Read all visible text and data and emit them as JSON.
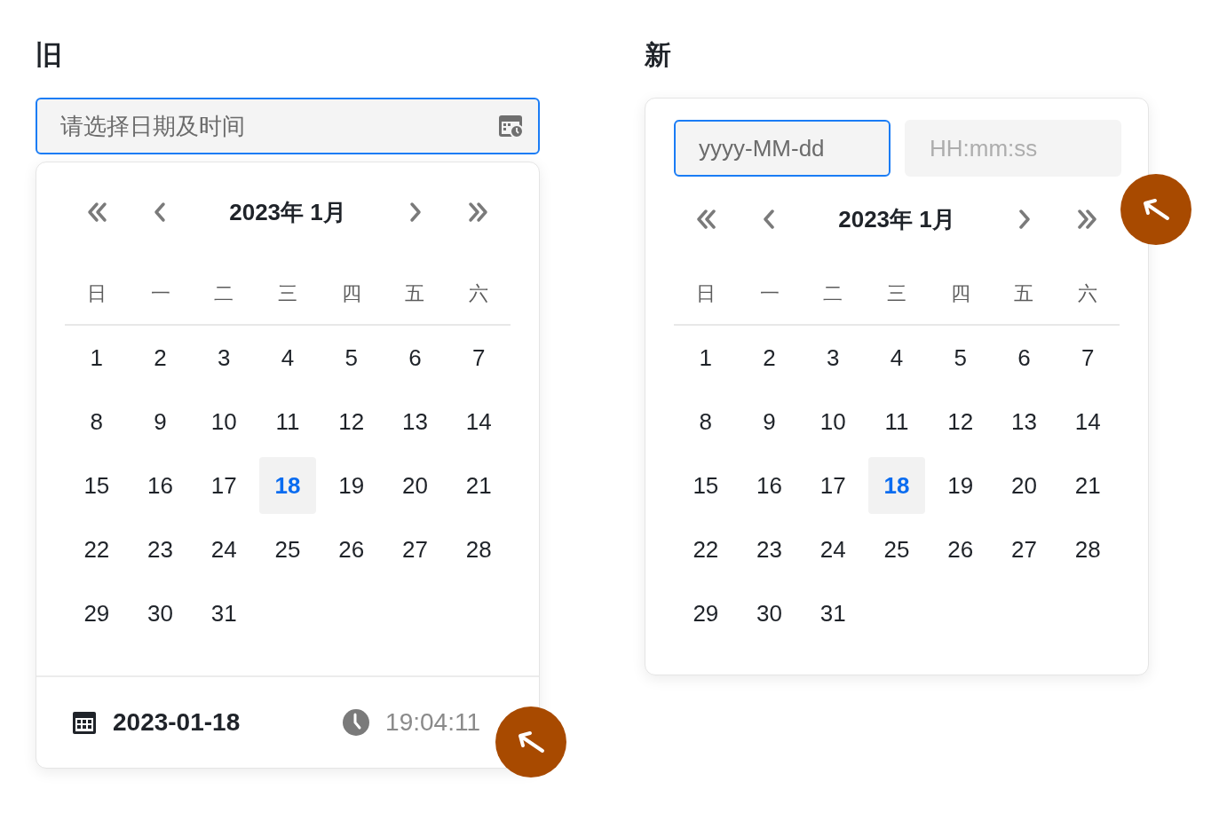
{
  "panels": [
    {
      "title": "旧",
      "kind": "single",
      "input": {
        "placeholder": "请选择日期及时间",
        "focused": true
      },
      "calendar": {
        "month_label": "2023年 1月",
        "weekdays": [
          "日",
          "一",
          "二",
          "三",
          "四",
          "五",
          "六"
        ],
        "days": [
          {
            "label": "1",
            "selected": false
          },
          {
            "label": "2",
            "selected": false
          },
          {
            "label": "3",
            "selected": false
          },
          {
            "label": "4",
            "selected": false
          },
          {
            "label": "5",
            "selected": false
          },
          {
            "label": "6",
            "selected": false
          },
          {
            "label": "7",
            "selected": false
          },
          {
            "label": "8",
            "selected": false
          },
          {
            "label": "9",
            "selected": false
          },
          {
            "label": "10",
            "selected": false
          },
          {
            "label": "11",
            "selected": false
          },
          {
            "label": "12",
            "selected": false
          },
          {
            "label": "13",
            "selected": false
          },
          {
            "label": "14",
            "selected": false
          },
          {
            "label": "15",
            "selected": false
          },
          {
            "label": "16",
            "selected": false
          },
          {
            "label": "17",
            "selected": false
          },
          {
            "label": "18",
            "selected": true
          },
          {
            "label": "19",
            "selected": false
          },
          {
            "label": "20",
            "selected": false
          },
          {
            "label": "21",
            "selected": false
          },
          {
            "label": "22",
            "selected": false
          },
          {
            "label": "23",
            "selected": false
          },
          {
            "label": "24",
            "selected": false
          },
          {
            "label": "25",
            "selected": false
          },
          {
            "label": "26",
            "selected": false
          },
          {
            "label": "27",
            "selected": false
          },
          {
            "label": "28",
            "selected": false
          },
          {
            "label": "29",
            "selected": false
          },
          {
            "label": "30",
            "selected": false
          },
          {
            "label": "31",
            "selected": false
          }
        ]
      },
      "footer": {
        "date": "2023-01-18",
        "time": "19:04:11"
      }
    },
    {
      "title": "新",
      "kind": "split",
      "date_input": {
        "placeholder": "yyyy-MM-dd",
        "focused": true
      },
      "time_input": {
        "placeholder": "HH:mm:ss",
        "focused": false
      },
      "calendar": {
        "month_label": "2023年 1月",
        "weekdays": [
          "日",
          "一",
          "二",
          "三",
          "四",
          "五",
          "六"
        ],
        "days": [
          {
            "label": "1",
            "selected": false
          },
          {
            "label": "2",
            "selected": false
          },
          {
            "label": "3",
            "selected": false
          },
          {
            "label": "4",
            "selected": false
          },
          {
            "label": "5",
            "selected": false
          },
          {
            "label": "6",
            "selected": false
          },
          {
            "label": "7",
            "selected": false
          },
          {
            "label": "8",
            "selected": false
          },
          {
            "label": "9",
            "selected": false
          },
          {
            "label": "10",
            "selected": false
          },
          {
            "label": "11",
            "selected": false
          },
          {
            "label": "12",
            "selected": false
          },
          {
            "label": "13",
            "selected": false
          },
          {
            "label": "14",
            "selected": false
          },
          {
            "label": "15",
            "selected": false
          },
          {
            "label": "16",
            "selected": false
          },
          {
            "label": "17",
            "selected": false
          },
          {
            "label": "18",
            "selected": true
          },
          {
            "label": "19",
            "selected": false
          },
          {
            "label": "20",
            "selected": false
          },
          {
            "label": "21",
            "selected": false
          },
          {
            "label": "22",
            "selected": false
          },
          {
            "label": "23",
            "selected": false
          },
          {
            "label": "24",
            "selected": false
          },
          {
            "label": "25",
            "selected": false
          },
          {
            "label": "26",
            "selected": false
          },
          {
            "label": "27",
            "selected": false
          },
          {
            "label": "28",
            "selected": false
          },
          {
            "label": "29",
            "selected": false
          },
          {
            "label": "30",
            "selected": false
          },
          {
            "label": "31",
            "selected": false
          }
        ]
      }
    }
  ]
}
